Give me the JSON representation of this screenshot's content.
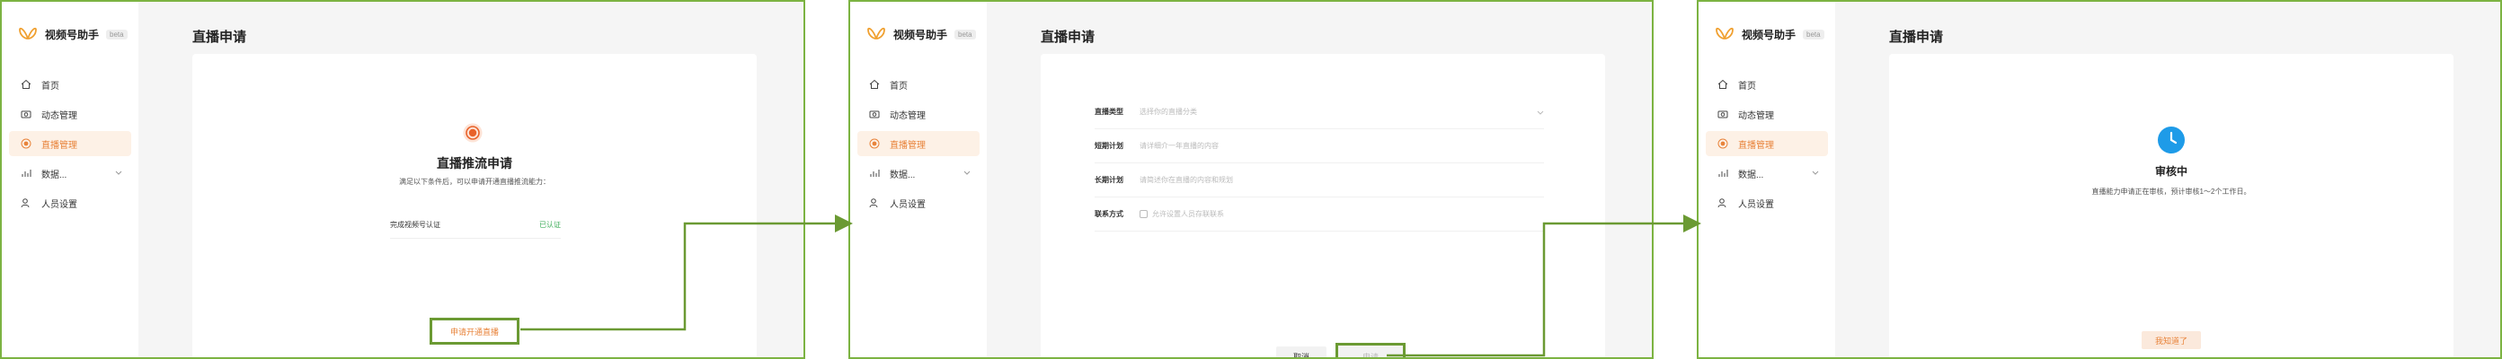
{
  "brand": {
    "name": "视频号助手",
    "tag": "beta"
  },
  "nav": {
    "items": [
      {
        "label": "首页",
        "icon": "home-icon"
      },
      {
        "label": "动态管理",
        "icon": "camera-icon"
      },
      {
        "label": "直播管理",
        "icon": "live-icon"
      },
      {
        "label": "数据...",
        "icon": "chart-icon"
      },
      {
        "label": "人员设置",
        "icon": "user-icon"
      }
    ],
    "active_index": 2
  },
  "page_title": "直播申请",
  "screens": {
    "apply": {
      "title": "直播推流申请",
      "description": "满足以下条件后，可以申请开通直播推流能力：",
      "requirement_label": "完成视频号认证",
      "requirement_status": "已认证",
      "apply_button": "申请开通直播"
    },
    "form": {
      "fields": [
        {
          "label": "直播类型",
          "placeholder": "选择你的直播分类",
          "has_dropdown": true
        },
        {
          "label": "短期计划",
          "placeholder": "请详细介一年直播的内容",
          "has_dropdown": false
        },
        {
          "label": "长期计划",
          "placeholder": "请简述你在直播的内容和规划",
          "has_dropdown": false
        },
        {
          "label": "联系方式",
          "placeholder": "允许设置人员存联联系",
          "has_dropdown": false,
          "checkbox": true
        }
      ],
      "cancel_button": "取消",
      "submit_button": "申请"
    },
    "review": {
      "title": "审核中",
      "description": "直播能力申请正在审核，预计审核1～2个工作日。",
      "ack_button": "我知道了"
    }
  },
  "colors": {
    "accent": "#e8833a",
    "active_bg": "#fdf1e6",
    "success": "#3fae5b",
    "highlight_border": "#6b9a33",
    "panel_border": "#7cb342",
    "review_icon": "#1e9be8"
  }
}
